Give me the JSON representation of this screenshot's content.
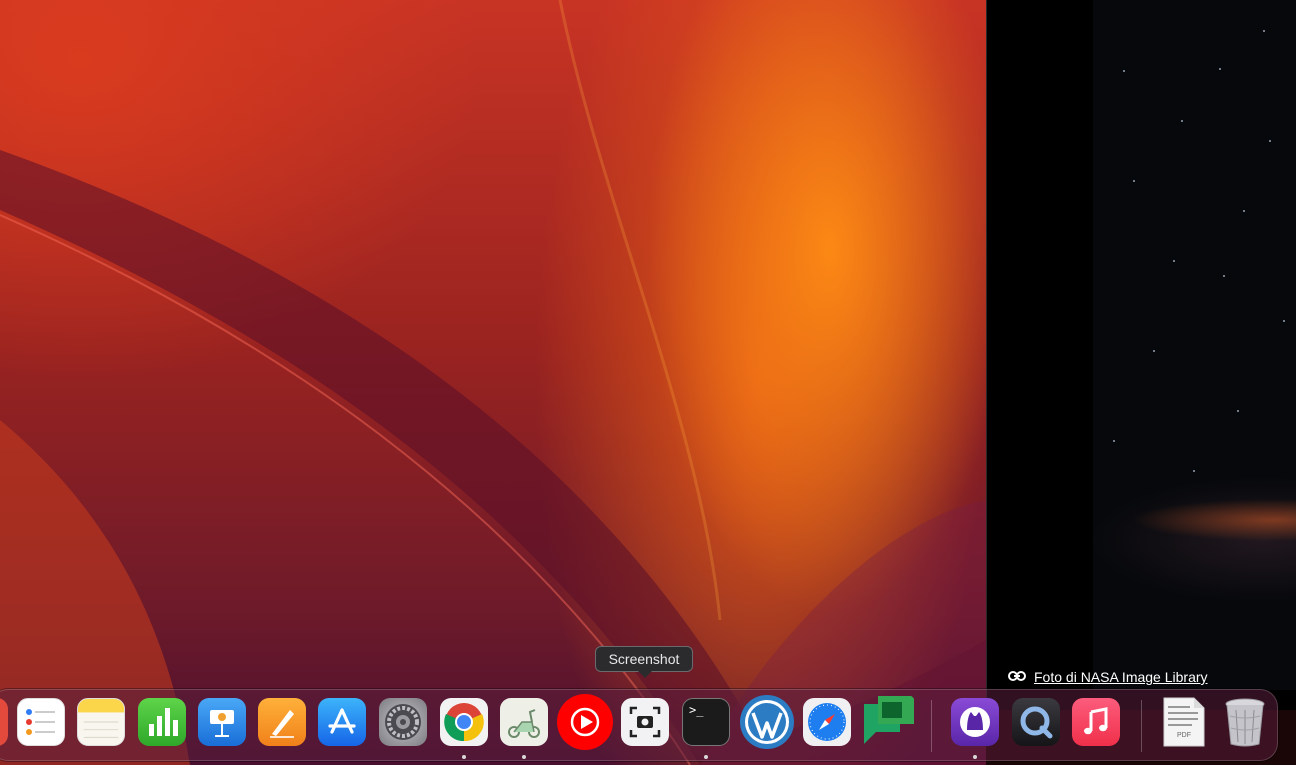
{
  "tooltip": {
    "text": "Screenshot"
  },
  "photo_credit": {
    "text": "Foto di NASA Image Library",
    "icon": "link-icon"
  },
  "dock": {
    "apps": [
      {
        "name": "Reminders",
        "icon": "reminders-icon",
        "running": false
      },
      {
        "name": "Notes",
        "icon": "notes-icon",
        "running": false
      },
      {
        "name": "Numbers",
        "icon": "numbers-icon",
        "running": false
      },
      {
        "name": "Keynote",
        "icon": "keynote-icon",
        "running": false
      },
      {
        "name": "Pages",
        "icon": "pages-icon",
        "running": false
      },
      {
        "name": "App Store",
        "icon": "app-store-icon",
        "running": false
      },
      {
        "name": "System Settings",
        "icon": "gear-icon",
        "running": false
      },
      {
        "name": "Google Chrome",
        "icon": "chrome-icon",
        "running": true
      },
      {
        "name": "Scooter App",
        "icon": "scooter-icon",
        "running": true
      },
      {
        "name": "YouTube Music",
        "icon": "youtube-music-icon",
        "running": false
      },
      {
        "name": "Screenshot",
        "icon": "screenshot-icon",
        "running": false
      },
      {
        "name": "Terminal",
        "icon": "terminal-icon",
        "running": true
      },
      {
        "name": "WordPress",
        "icon": "wordpress-icon",
        "running": false
      },
      {
        "name": "Safari",
        "icon": "safari-icon",
        "running": false
      },
      {
        "name": "Google Chat",
        "icon": "google-chat-icon",
        "running": false
      },
      {
        "name": "GitHub Desktop",
        "icon": "github-icon",
        "running": true
      },
      {
        "name": "QuickTime Player",
        "icon": "quicktime-icon",
        "running": false
      },
      {
        "name": "Music",
        "icon": "music-icon",
        "running": false
      },
      {
        "name": "PDF Document",
        "icon": "pdf-icon",
        "label": "PDF",
        "running": false
      },
      {
        "name": "Trash",
        "icon": "trash-icon",
        "running": false
      }
    ]
  },
  "terminal_prompt": ">_"
}
